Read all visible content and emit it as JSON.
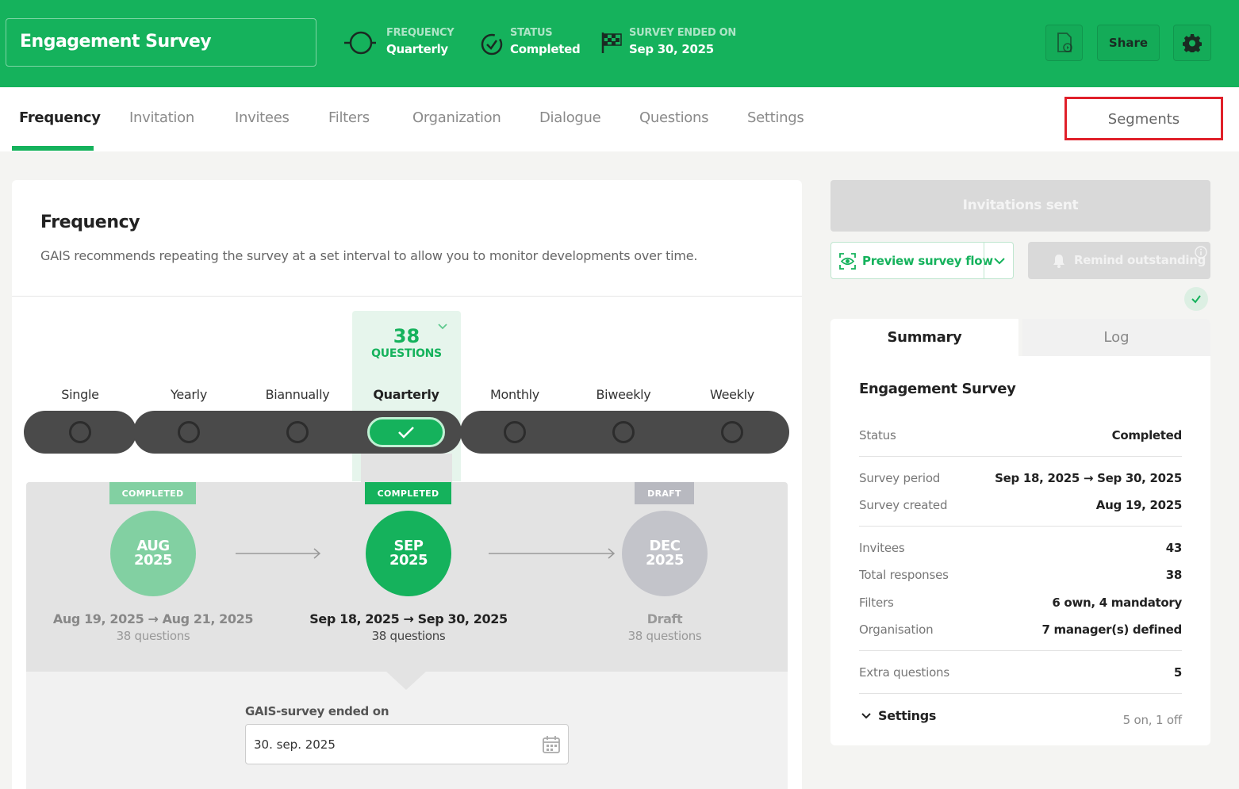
{
  "header": {
    "title": "Engagement Survey",
    "meta": [
      {
        "label": "FREQUENCY",
        "value": "Quarterly",
        "icon": "frequency-icon"
      },
      {
        "label": "STATUS",
        "value": "Completed",
        "icon": "check-circle-icon"
      },
      {
        "label": "SURVEY ENDED ON",
        "value": "Sep 30, 2025",
        "icon": "finish-flag-icon"
      }
    ],
    "share_label": "Share",
    "colors": {
      "brand": "#15b25c"
    }
  },
  "tabs": {
    "items": [
      "Frequency",
      "Invitation",
      "Invitees",
      "Filters",
      "Organization",
      "Dialogue",
      "Questions",
      "Settings"
    ],
    "segments": "Segments",
    "active": "Frequency"
  },
  "frequency": {
    "title": "Frequency",
    "description": "GAIS recommends repeating the survey at a set interval to allow you to monitor developments over time.",
    "questions_count": "38",
    "questions_label": "QUESTIONS",
    "options": [
      "Single",
      "Yearly",
      "Biannually",
      "Quarterly",
      "Monthly",
      "Biweekly",
      "Weekly"
    ],
    "selected": "Quarterly"
  },
  "timeline": [
    {
      "badge": "COMPLETED",
      "month": "AUG",
      "year": "2025",
      "range": "Aug 19, 2025 → Aug 21, 2025",
      "questions": "38 questions"
    },
    {
      "badge": "COMPLETED",
      "month": "SEP",
      "year": "2025",
      "range": "Sep 18, 2025 → Sep 30, 2025",
      "questions": "38 questions"
    },
    {
      "badge": "DRAFT",
      "month": "DEC",
      "year": "2025",
      "range": "Draft",
      "questions": "38 questions"
    }
  ],
  "ended": {
    "label": "GAIS-survey ended on",
    "value": "30. sep. 2025"
  },
  "actions": {
    "invitations_sent": "Invitations sent",
    "preview": "Preview survey flow",
    "remind": "Remind outstanding"
  },
  "summary": {
    "tab_summary": "Summary",
    "tab_log": "Log",
    "title": "Engagement Survey",
    "rows": [
      {
        "k": "Status",
        "v": "Completed"
      },
      {
        "k": "Survey period",
        "v": "Sep 18, 2025 → Sep 30, 2025"
      },
      {
        "k": "Survey created",
        "v": "Aug 19, 2025"
      },
      {
        "k": "Invitees",
        "v": "43"
      },
      {
        "k": "Total responses",
        "v": "38"
      },
      {
        "k": "Filters",
        "v": "6 own, 4 mandatory"
      },
      {
        "k": "Organisation",
        "v": "7 manager(s) defined"
      },
      {
        "k": "Extra questions",
        "v": "5"
      }
    ],
    "settings_label": "Settings",
    "settings_value": "5 on, 1 off"
  }
}
